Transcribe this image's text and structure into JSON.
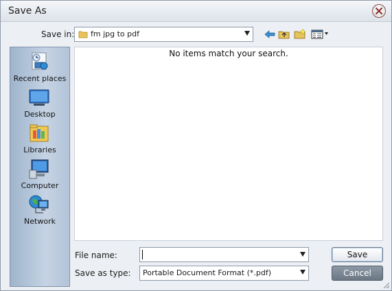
{
  "window": {
    "title": "Save As"
  },
  "save_in": {
    "label": "Save in:",
    "folder": "fm jpg to pdf"
  },
  "toolbar": {
    "icons": [
      "back-arrow-icon",
      "up-folder-icon",
      "new-folder-icon",
      "view-menu-icon"
    ]
  },
  "places": [
    {
      "label": "Recent places",
      "icon": "recent-places-icon"
    },
    {
      "label": "Desktop",
      "icon": "desktop-icon"
    },
    {
      "label": "Libraries",
      "icon": "libraries-icon"
    },
    {
      "label": "Computer",
      "icon": "computer-icon"
    },
    {
      "label": "Network",
      "icon": "network-icon"
    }
  ],
  "file_list": {
    "empty_message": "No items match your search."
  },
  "file_name": {
    "label": "File name:",
    "value": ""
  },
  "save_as_type": {
    "label": "Save as type:",
    "value": "Portable Document Format (*.pdf)"
  },
  "buttons": {
    "save": "Save",
    "cancel": "Cancel"
  },
  "colors": {
    "accent": "#3a6ea5",
    "cancel_bg": "#7a8692"
  }
}
